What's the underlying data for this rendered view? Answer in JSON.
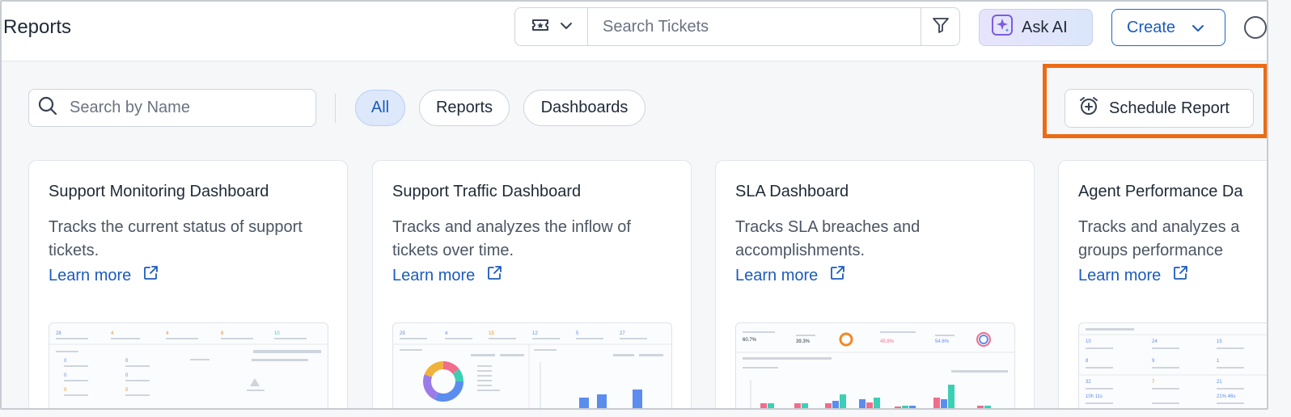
{
  "header": {
    "title": "Reports",
    "search_placeholder": "Search Tickets",
    "ask_ai_label": "Ask AI",
    "create_label": "Create"
  },
  "toolbar": {
    "search_placeholder": "Search by Name",
    "filters": [
      {
        "label": "All",
        "active": true
      },
      {
        "label": "Reports",
        "active": false
      },
      {
        "label": "Dashboards",
        "active": false
      }
    ],
    "schedule_label": "Schedule Report"
  },
  "cards": [
    {
      "title": "Support Monitoring Dashboard",
      "description": "Tracks the current status of support tickets.",
      "link": "Learn more"
    },
    {
      "title": "Support Traffic Dashboard",
      "description": "Tracks and analyzes the inflow of tickets over time.",
      "link": "Learn more"
    },
    {
      "title": "SLA Dashboard",
      "description": "Tracks SLA breaches and accomplishments.",
      "link": "Learn more"
    },
    {
      "title": "Agent Performance Da",
      "description": "Tracks and analyzes a groups performance",
      "link": "Learn more"
    }
  ],
  "colors": {
    "accent": "#1c5bbd",
    "highlight": "#ec6b13",
    "chart_blue": "#5b8def",
    "chart_teal": "#3ccfb4",
    "chart_pink": "#f06d8c"
  },
  "icons": [
    "ticket-icon",
    "chevron-down-icon",
    "filter-icon",
    "sparkle-icon",
    "help-icon",
    "search-icon",
    "alarm-plus-icon",
    "external-link-icon"
  ]
}
